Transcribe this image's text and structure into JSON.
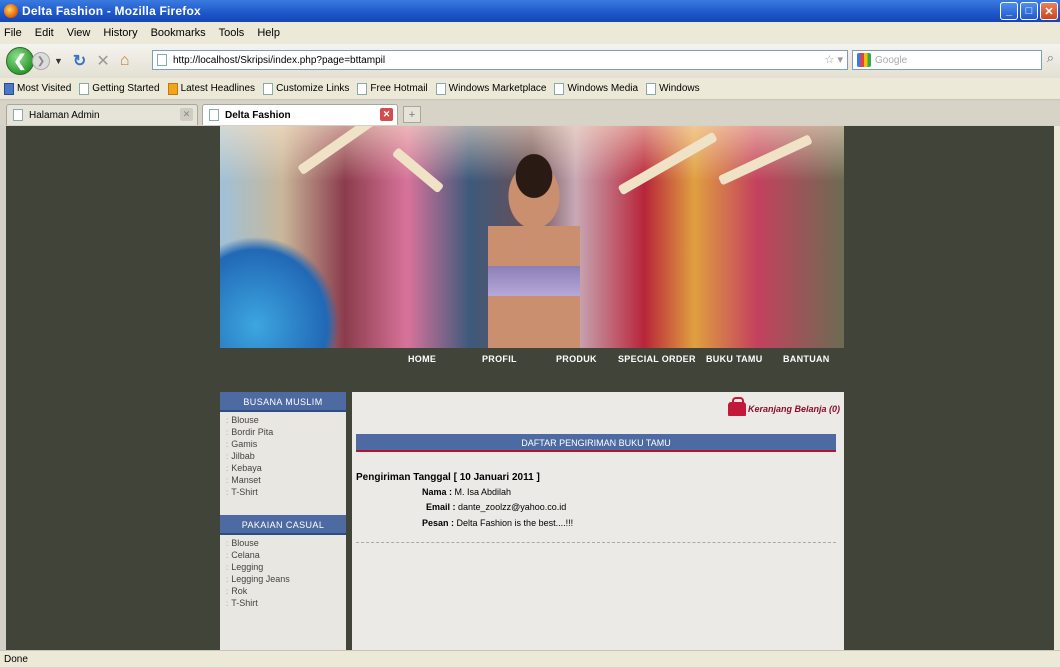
{
  "window": {
    "title": "Delta Fashion - Mozilla Firefox"
  },
  "menu": [
    "File",
    "Edit",
    "View",
    "History",
    "Bookmarks",
    "Tools",
    "Help"
  ],
  "address": {
    "url": "http://localhost/Skripsi/index.php?page=bttampil"
  },
  "search": {
    "placeholder": "Google"
  },
  "bookmarks": [
    "Most Visited",
    "Getting Started",
    "Latest Headlines",
    "Customize Links",
    "Free Hotmail",
    "Windows Marketplace",
    "Windows Media",
    "Windows"
  ],
  "tabs": [
    {
      "label": "Halaman Admin"
    },
    {
      "label": "Delta Fashion"
    }
  ],
  "site": {
    "nav": [
      "HOME",
      "PROFIL",
      "PRODUK",
      "SPECIAL ORDER",
      "BUKU TAMU",
      "BANTUAN"
    ],
    "sidebar": {
      "group1": {
        "title": "BUSANA MUSLIM",
        "items": [
          "Blouse",
          "Bordir Pita",
          "Gamis",
          "Jilbab",
          "Kebaya",
          "Manset",
          "T-Shirt"
        ]
      },
      "group2": {
        "title": "PAKAIAN CASUAL",
        "items": [
          "Blouse",
          "Celana",
          "Legging",
          "Legging Jeans",
          "Rok",
          "T-Shirt"
        ]
      }
    },
    "cart": "Keranjang Belanja (0)",
    "section_title": "DAFTAR PENGIRIMAN BUKU TAMU",
    "entry": {
      "date": "Pengiriman Tanggal [ 10 Januari 2011 ]",
      "name_label": "Nama :",
      "name": "M. Isa Abdilah",
      "email_label": "Email :",
      "email": "dante_zoolzz@yahoo.co.id",
      "message_label": "Pesan :",
      "message": "Delta Fashion is the best....!!!"
    }
  },
  "status": "Done"
}
